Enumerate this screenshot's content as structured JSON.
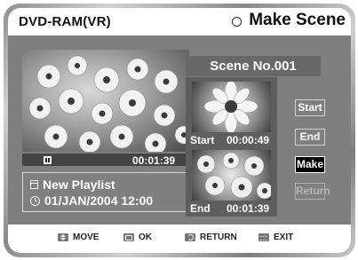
{
  "header": {
    "disc_type": "DVD-RAM(VR)",
    "title": "Make Scene",
    "mode_icon": "circle-icon"
  },
  "player": {
    "state_icon": "pause-icon",
    "elapsed": "00:01:39"
  },
  "info": {
    "playlist_name": "New Playlist",
    "datetime": "01/JAN/2004 12:00"
  },
  "scene": {
    "label": "Scene No.001",
    "start": {
      "label": "Start",
      "time": "00:00:49"
    },
    "end": {
      "label": "End",
      "time": "00:01:39"
    }
  },
  "buttons": {
    "start": "Start",
    "end": "End",
    "make": "Make",
    "return": "Return"
  },
  "footer": {
    "move": "MOVE",
    "ok": "OK",
    "return": "RETURN",
    "exit": "EXIT"
  }
}
